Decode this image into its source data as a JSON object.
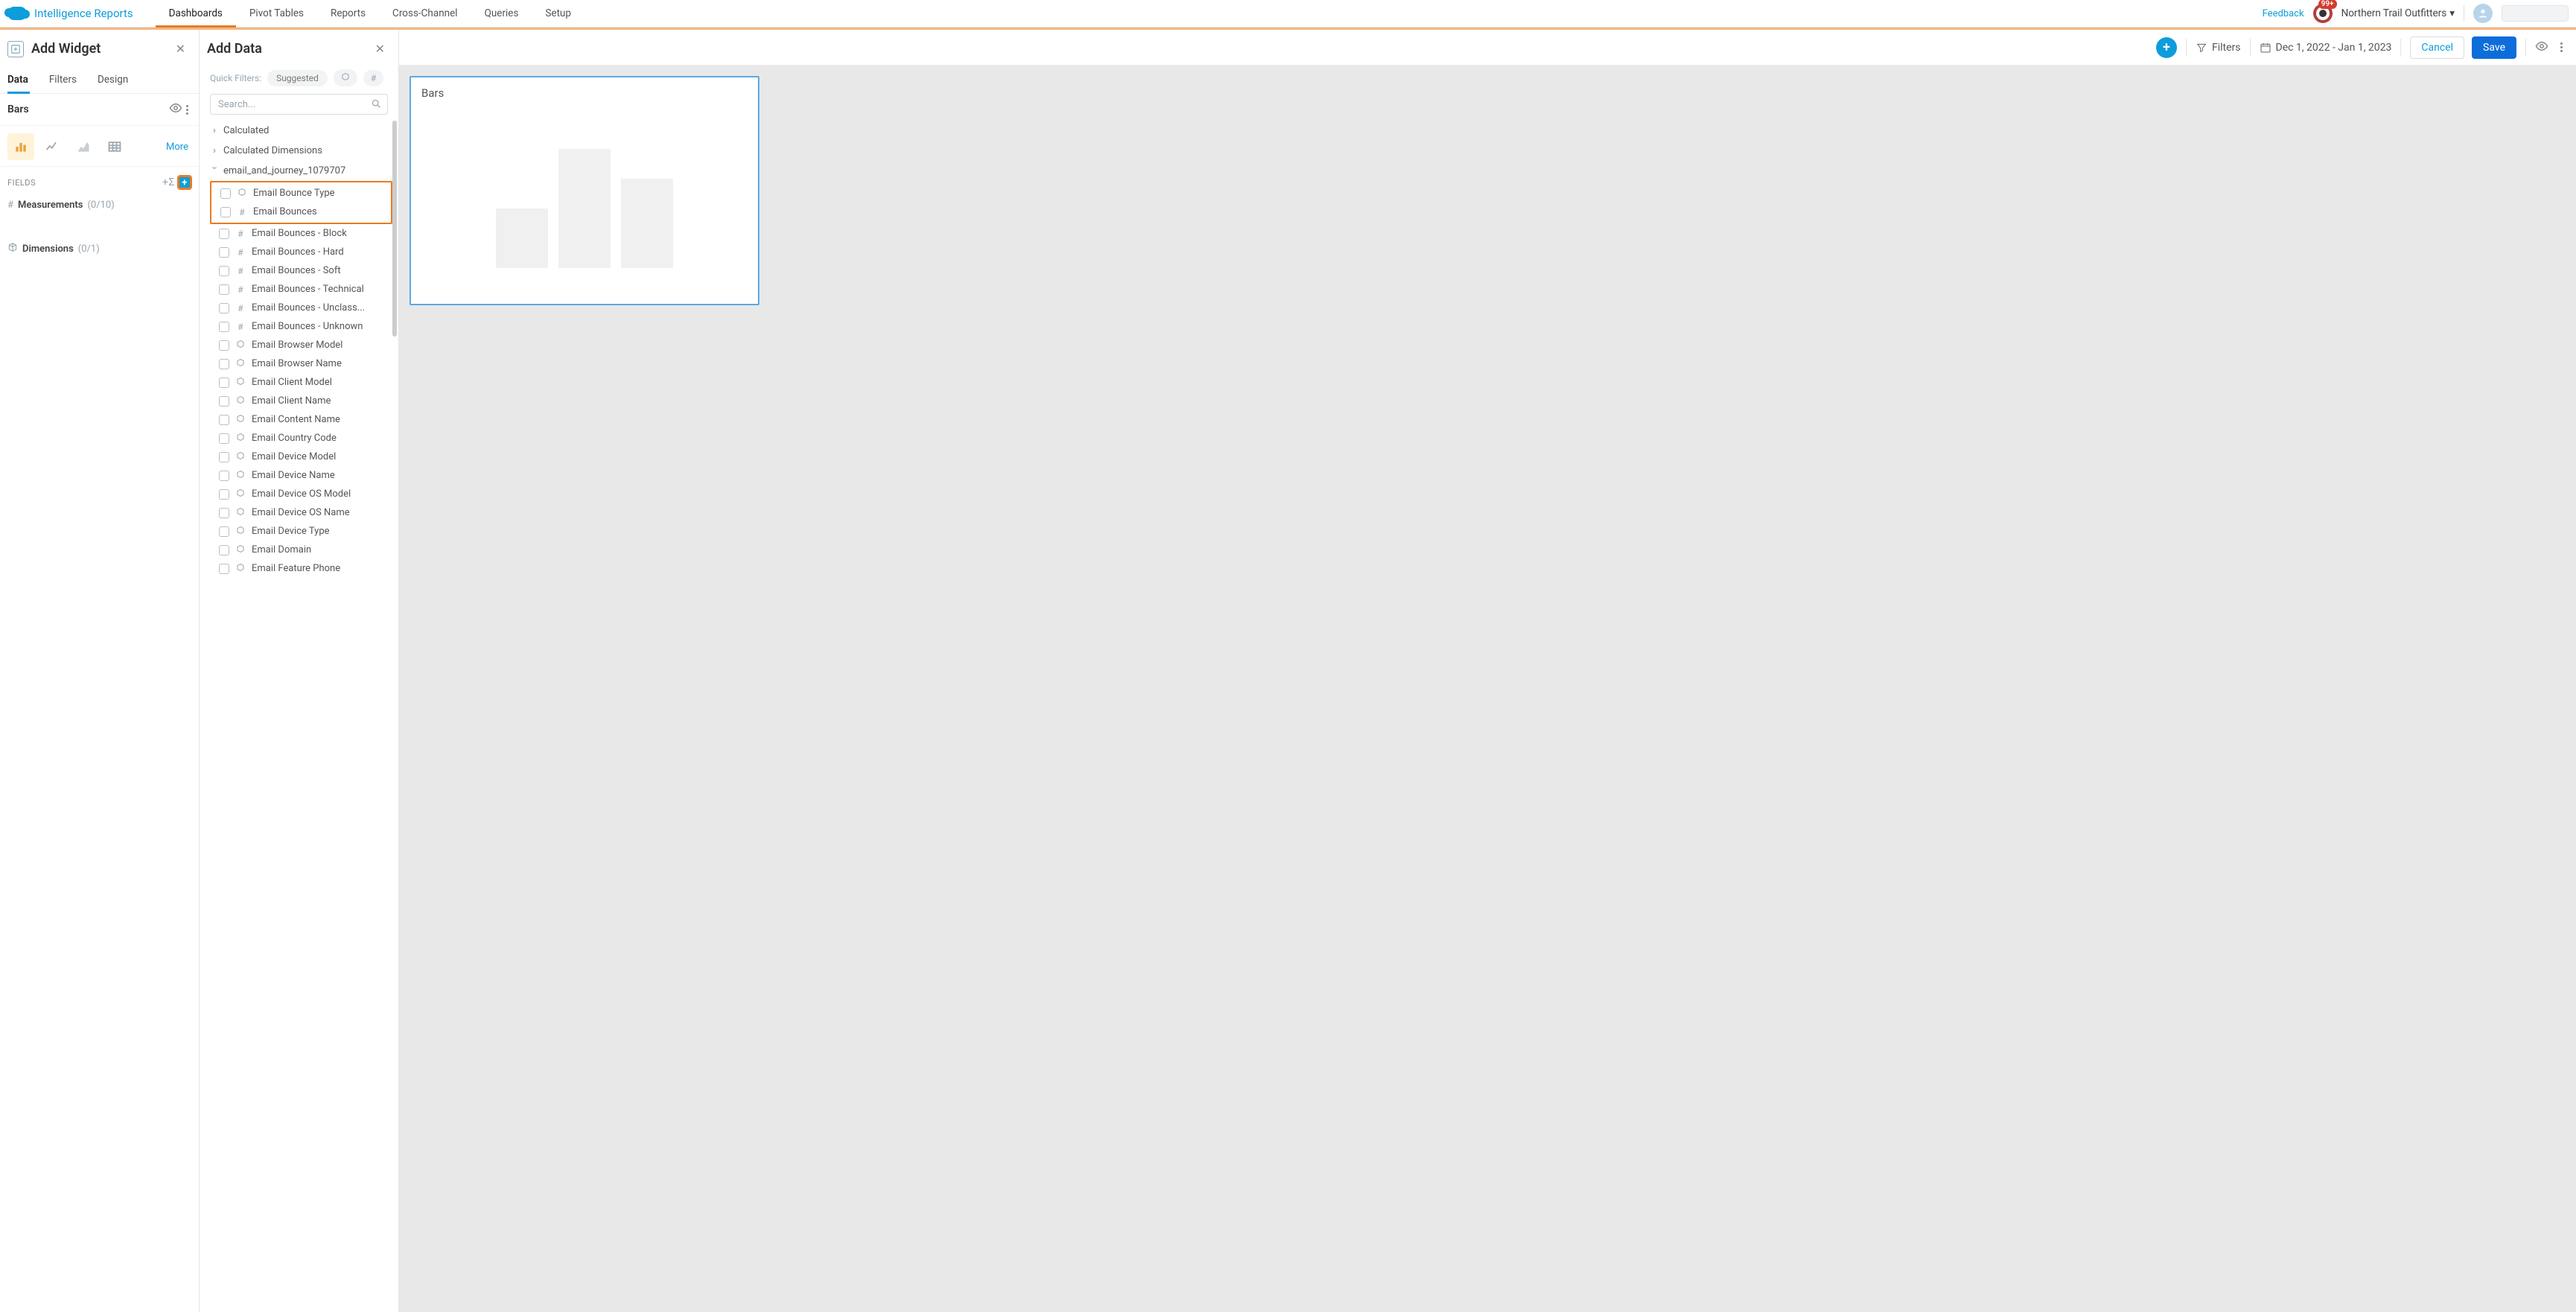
{
  "header": {
    "app_title": "Intelligence Reports",
    "tabs": [
      "Dashboards",
      "Pivot Tables",
      "Reports",
      "Cross-Channel",
      "Queries",
      "Setup"
    ],
    "active_tab_index": 0,
    "feedback_label": "Feedback",
    "notification_count": "99+",
    "org_name": "Northern Trail Outfitters"
  },
  "left_panel": {
    "title": "Add Widget",
    "tabs": [
      "Data",
      "Filters",
      "Design"
    ],
    "active_tab_index": 0,
    "chart_name": "Bars",
    "more_label": "More",
    "fields_label": "FIELDS",
    "measurements": {
      "label": "Measurements",
      "count": "(0/10)"
    },
    "dimensions": {
      "label": "Dimensions",
      "count": "(0/1)"
    }
  },
  "add_data_panel": {
    "title": "Add Data",
    "quick_filters_label": "Quick Filters:",
    "suggested_chip": "Suggested",
    "search_placeholder": "Search...",
    "groups": [
      {
        "label": "Calculated",
        "expanded": false
      },
      {
        "label": "Calculated Dimensions",
        "expanded": false
      },
      {
        "label": "email_and_journey_1079707",
        "expanded": true
      }
    ],
    "highlighted_items": [
      {
        "type": "dim",
        "label": "Email Bounce Type"
      },
      {
        "type": "meas",
        "label": "Email Bounces"
      }
    ],
    "items": [
      {
        "type": "meas",
        "label": "Email Bounces - Block"
      },
      {
        "type": "meas",
        "label": "Email Bounces - Hard"
      },
      {
        "type": "meas",
        "label": "Email Bounces - Soft"
      },
      {
        "type": "meas",
        "label": "Email Bounces - Technical"
      },
      {
        "type": "meas",
        "label": "Email Bounces - Unclass..."
      },
      {
        "type": "meas",
        "label": "Email Bounces - Unknown"
      },
      {
        "type": "dim",
        "label": "Email Browser Model"
      },
      {
        "type": "dim",
        "label": "Email Browser Name"
      },
      {
        "type": "dim",
        "label": "Email Client Model"
      },
      {
        "type": "dim",
        "label": "Email Client Name"
      },
      {
        "type": "dim",
        "label": "Email Content Name"
      },
      {
        "type": "dim",
        "label": "Email Country Code"
      },
      {
        "type": "dim",
        "label": "Email Device Model"
      },
      {
        "type": "dim",
        "label": "Email Device Name"
      },
      {
        "type": "dim",
        "label": "Email Device OS Model"
      },
      {
        "type": "dim",
        "label": "Email Device OS Name"
      },
      {
        "type": "dim",
        "label": "Email Device Type"
      },
      {
        "type": "dim",
        "label": "Email Domain"
      },
      {
        "type": "dim",
        "label": "Email Feature Phone"
      }
    ]
  },
  "toolbar": {
    "filters_label": "Filters",
    "date_range": "Dec 1, 2022 - Jan 1, 2023",
    "cancel_label": "Cancel",
    "save_label": "Save"
  },
  "canvas": {
    "widget_title": "Bars"
  }
}
